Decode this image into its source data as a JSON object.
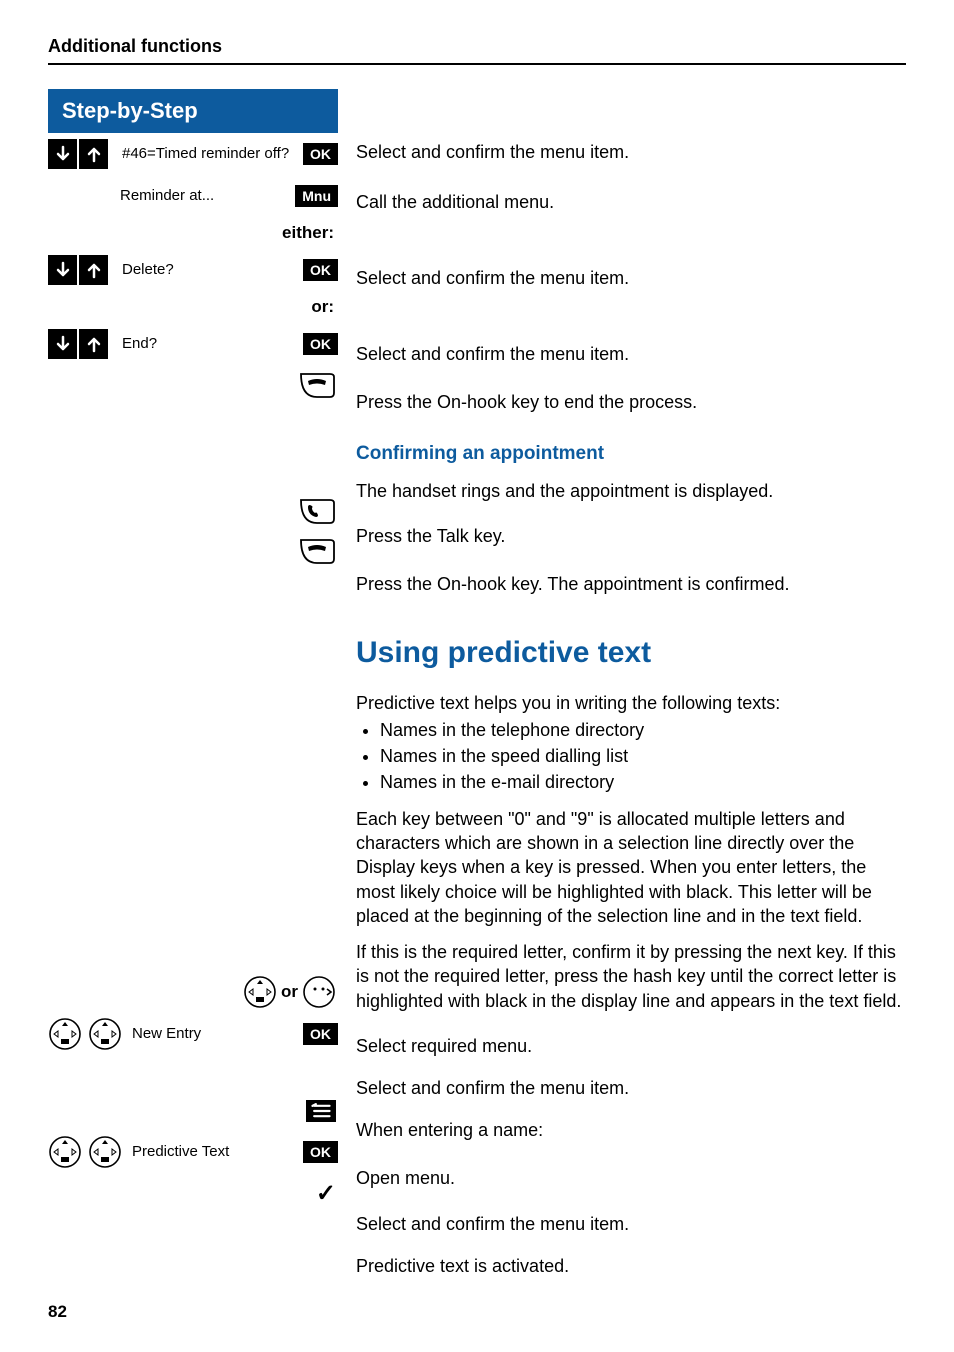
{
  "header": {
    "title": "Additional functions"
  },
  "stepbox": {
    "title": "Step-by-Step"
  },
  "steps": {
    "s1": {
      "display": "#46=Timed reminder off?",
      "key": "OK",
      "desc": "Select and confirm the menu item."
    },
    "s2": {
      "display": "Reminder at...",
      "key": "Mnu",
      "desc": "Call the additional menu."
    },
    "either": "either:",
    "s3": {
      "display": "Delete?",
      "key": "OK",
      "desc": "Select and confirm the menu item."
    },
    "or": "or:",
    "s4": {
      "display": "End?",
      "key": "OK",
      "desc": "Select and confirm the menu item."
    },
    "s5": {
      "desc": "Press the On-hook key to end the process."
    }
  },
  "confirm": {
    "heading": "Confirming an appointment",
    "intro": "The handset rings and the appointment is displayed.",
    "talk": "Press the Talk key.",
    "onhook": "Press the On-hook key. The appointment is confirmed."
  },
  "predictive": {
    "heading": "Using predictive text",
    "intro": "Predictive text helps you in writing the following texts:",
    "bullets": {
      "b1": "Names in the telephone directory",
      "b2": "Names in the speed dialling list",
      "b3": "Names in the e-mail directory"
    },
    "para1": "Each key between \"0\" and \"9\" is allocated multiple letters and characters which are shown in a selection line directly over the Display keys when a key is pressed. When you enter letters, the most likely choice will be highlighted with black. This letter will be placed at the beginning of the selection line and in the text field.",
    "para2": "If this is the required letter, confirm it by pressing the next key. If this is not the required letter, press the hash key until the correct letter is highlighted with black in the display line and appears in the text field.",
    "r1": {
      "or": "or",
      "desc": "Select required menu."
    },
    "r2": {
      "display": "New Entry",
      "key": "OK",
      "desc": "Select and confirm the menu item."
    },
    "r3": {
      "desc": "When entering a name:"
    },
    "r4": {
      "desc": "Open menu."
    },
    "r5": {
      "display": "Predictive Text",
      "key": "OK",
      "desc": "Select and confirm the menu item."
    },
    "r6": {
      "desc": "Predictive text is activated."
    }
  },
  "page": "82"
}
